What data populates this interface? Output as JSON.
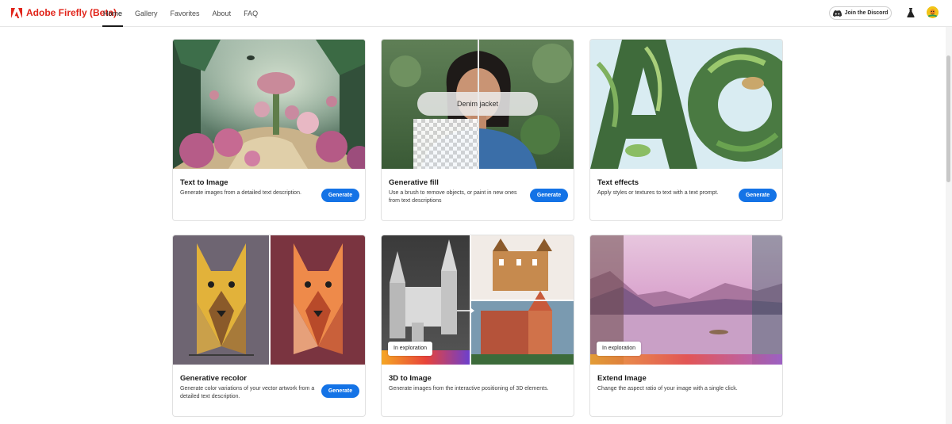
{
  "app": {
    "brand_name": "Adobe Firefly (Beta)",
    "brand_color": "#e1251b",
    "accent_color": "#1473e6"
  },
  "nav": {
    "items": [
      {
        "label": "Home",
        "active": true
      },
      {
        "label": "Gallery",
        "active": false
      },
      {
        "label": "Favorites",
        "active": false
      },
      {
        "label": "About",
        "active": false
      },
      {
        "label": "FAQ",
        "active": false
      }
    ]
  },
  "header_actions": {
    "discord_label": "Join the Discord",
    "icons": [
      "discord-icon",
      "flask-icon",
      "avatar"
    ]
  },
  "cards": [
    {
      "title": "Text to Image",
      "description": "Generate images from a detailed text description.",
      "button": "Generate"
    },
    {
      "title": "Generative fill",
      "description": "Use a brush to remove objects, or paint in new ones from text descriptions",
      "button": "Generate",
      "image_prompt": "Denim jacket"
    },
    {
      "title": "Text effects",
      "description": "Apply styles or textures to text with a text prompt.",
      "button": "Generate"
    },
    {
      "title": "Generative recolor",
      "description": "Generate color variations of your vector artwork from a detailed text description.",
      "button": "Generate"
    },
    {
      "title": "3D to Image",
      "description": "Generate images from the interactive positioning of 3D elements.",
      "badge": "In exploration"
    },
    {
      "title": "Extend Image",
      "description": "Change the aspect ratio of your image with a single click.",
      "badge": "In exploration"
    }
  ]
}
